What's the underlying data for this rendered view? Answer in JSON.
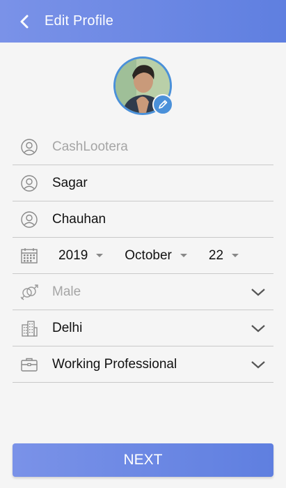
{
  "header": {
    "title": "Edit Profile",
    "back_icon": "chevron-left-icon"
  },
  "profile": {
    "avatar_icon": "avatar",
    "edit_icon": "pencil-icon"
  },
  "fields": {
    "username": {
      "placeholder": "CashLootera",
      "icon": "user-icon"
    },
    "first_name": {
      "value": "Sagar",
      "icon": "user-icon"
    },
    "last_name": {
      "value": "Chauhan",
      "icon": "user-icon"
    },
    "dob": {
      "year": "2019",
      "month": "October",
      "day": "22",
      "icon": "calendar-icon"
    },
    "gender": {
      "placeholder": "Male",
      "icon": "gender-icon"
    },
    "city": {
      "value": "Delhi",
      "icon": "city-icon"
    },
    "occupation": {
      "value": "Working Professional",
      "icon": "briefcase-icon"
    }
  },
  "actions": {
    "next_label": "NEXT"
  },
  "colors": {
    "accent": "#6b88e4",
    "avatar_ring": "#4a90d9"
  }
}
